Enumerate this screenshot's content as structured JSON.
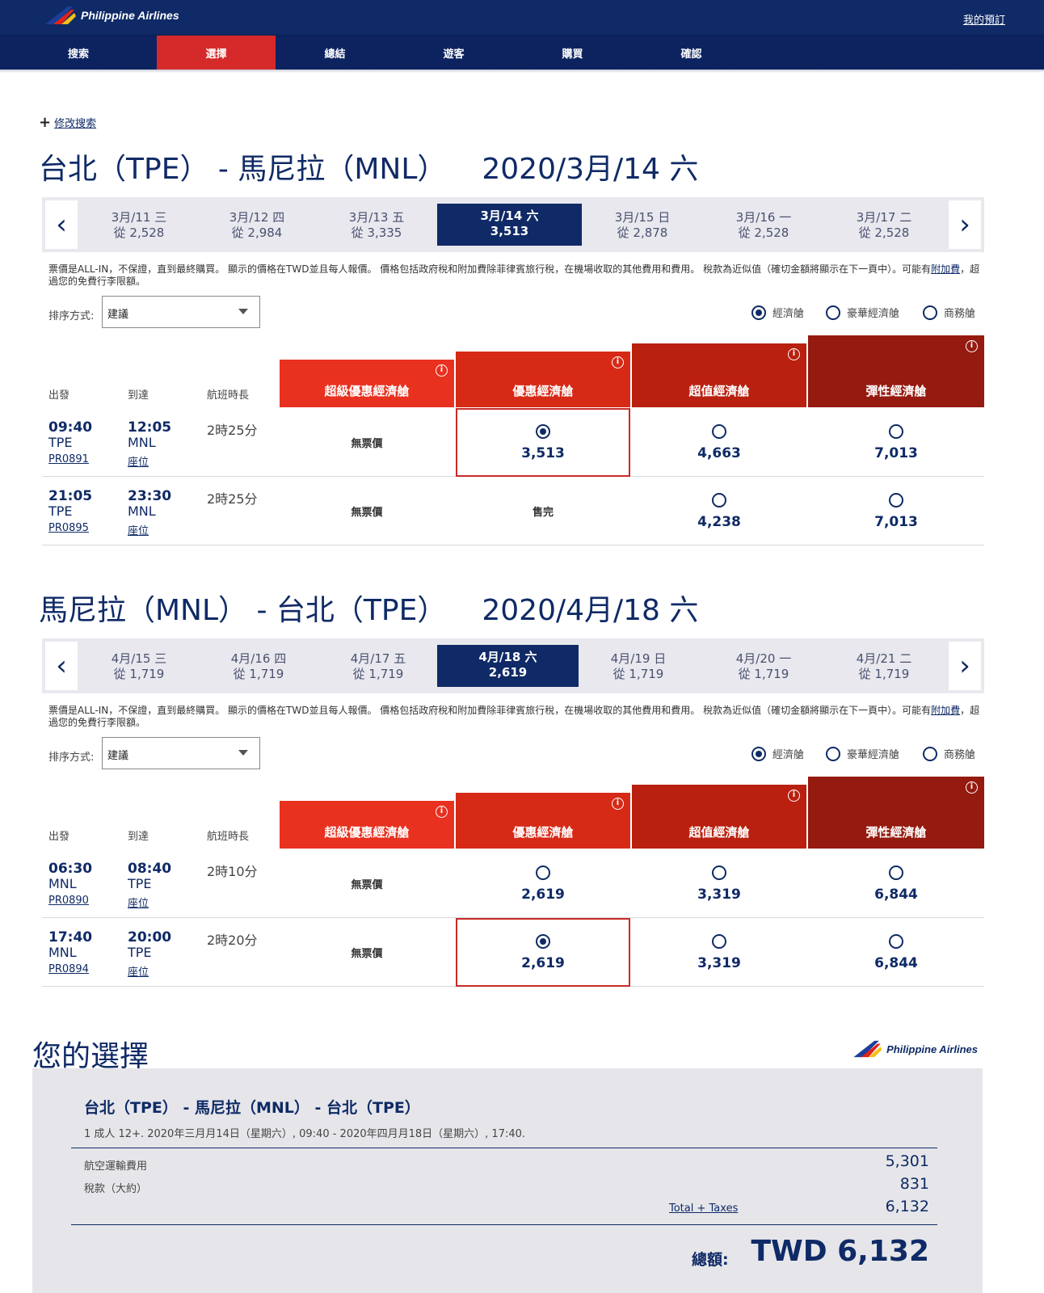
{
  "header": {
    "brand": "Philippine Airlines",
    "my_booking": "我的預訂"
  },
  "steps": [
    "搜索",
    "選擇",
    "總結",
    "遊客",
    "購買",
    "確認"
  ],
  "modify_search": "修改搜索",
  "notice": {
    "text": "票價是ALL-IN，不保證，直到最終購買。 顯示的價格在TWD並且每人報價。 價格包括政府稅和附加費除菲律賓旅行稅，在機場收取的其他費用和費用。 稅款為近似值（確切金額將顯示在下一頁中）。可能有",
    "link": "附加費",
    "after": "，超過您的免費行李限額。"
  },
  "sort": {
    "label": "排序方式:",
    "value": "建議"
  },
  "cabins": [
    "經濟艙",
    "豪華經濟艙",
    "商務艙"
  ],
  "table_headers": {
    "depart": "出發",
    "arrive": "到達",
    "duration": "航班時長"
  },
  "fare_classes": [
    "超級優惠經濟艙",
    "優惠經濟艙",
    "超值經濟艙",
    "彈性經濟艙"
  ],
  "info_icon": "i",
  "outbound": {
    "route": "台北（TPE） - 馬尼拉（MNL）",
    "date": "2020/3月/14 六",
    "dates": [
      {
        "d": "3月/11 三",
        "p": "從 2,528"
      },
      {
        "d": "3月/12 四",
        "p": "從 2,984"
      },
      {
        "d": "3月/13 五",
        "p": "從 3,335"
      },
      {
        "d": "3月/14 六",
        "p": "3,513"
      },
      {
        "d": "3月/15 日",
        "p": "從 2,878"
      },
      {
        "d": "3月/16 一",
        "p": "從 2,528"
      },
      {
        "d": "3月/17 二",
        "p": "從 2,528"
      }
    ],
    "flights": [
      {
        "dep": "09:40",
        "depc": "TPE",
        "arr": "12:05",
        "arrc": "MNL",
        "no": "PR0891",
        "seat": "座位",
        "dur": "2時25分",
        "f1": "無票價",
        "f2": "3,513",
        "f3": "4,663",
        "f4": "7,013"
      },
      {
        "dep": "21:05",
        "depc": "TPE",
        "arr": "23:30",
        "arrc": "MNL",
        "no": "PR0895",
        "seat": "座位",
        "dur": "2時25分",
        "f1": "無票價",
        "f2": "售完",
        "f3": "4,238",
        "f4": "7,013"
      }
    ]
  },
  "inbound": {
    "route": "馬尼拉（MNL） - 台北（TPE）",
    "date": "2020/4月/18 六",
    "dates": [
      {
        "d": "4月/15 三",
        "p": "從 1,719"
      },
      {
        "d": "4月/16 四",
        "p": "從 1,719"
      },
      {
        "d": "4月/17 五",
        "p": "從 1,719"
      },
      {
        "d": "4月/18 六",
        "p": "2,619"
      },
      {
        "d": "4月/19 日",
        "p": "從 1,719"
      },
      {
        "d": "4月/20 一",
        "p": "從 1,719"
      },
      {
        "d": "4月/21 二",
        "p": "從 1,719"
      }
    ],
    "flights": [
      {
        "dep": "06:30",
        "depc": "MNL",
        "arr": "08:40",
        "arrc": "TPE",
        "no": "PR0890",
        "seat": "座位",
        "dur": "2時10分",
        "f1": "無票價",
        "f2": "2,619",
        "f3": "3,319",
        "f4": "6,844"
      },
      {
        "dep": "17:40",
        "depc": "MNL",
        "arr": "20:00",
        "arrc": "TPE",
        "no": "PR0894",
        "seat": "座位",
        "dur": "2時20分",
        "f1": "無票價",
        "f2": "2,619",
        "f3": "3,319",
        "f4": "6,844"
      }
    ]
  },
  "summary": {
    "title": "您的選擇",
    "brand": "Philippine Airlines",
    "route": "台北（TPE） - 馬尼拉（MNL） - 台北（TPE）",
    "sub": "1 成人 12+. 2020年三月月14日（星期六）, 09:40 - 2020年四月月18日（星期六）, 17:40.",
    "air_label": "航空運輸費用",
    "air_value": "5,301",
    "tax_label": "稅款（大約）",
    "tax_value": "831",
    "total_link": "Total + Taxes",
    "total_value": "6,132",
    "grand_label": "總額:",
    "grand_value": "TWD 6,132"
  },
  "colors": {
    "navy": "#0f2a66",
    "active_step": "#d62a2a",
    "fare1": "#e8311f",
    "fare2": "#d62a17",
    "fare3": "#b9200f",
    "fare4": "#951a0f"
  }
}
